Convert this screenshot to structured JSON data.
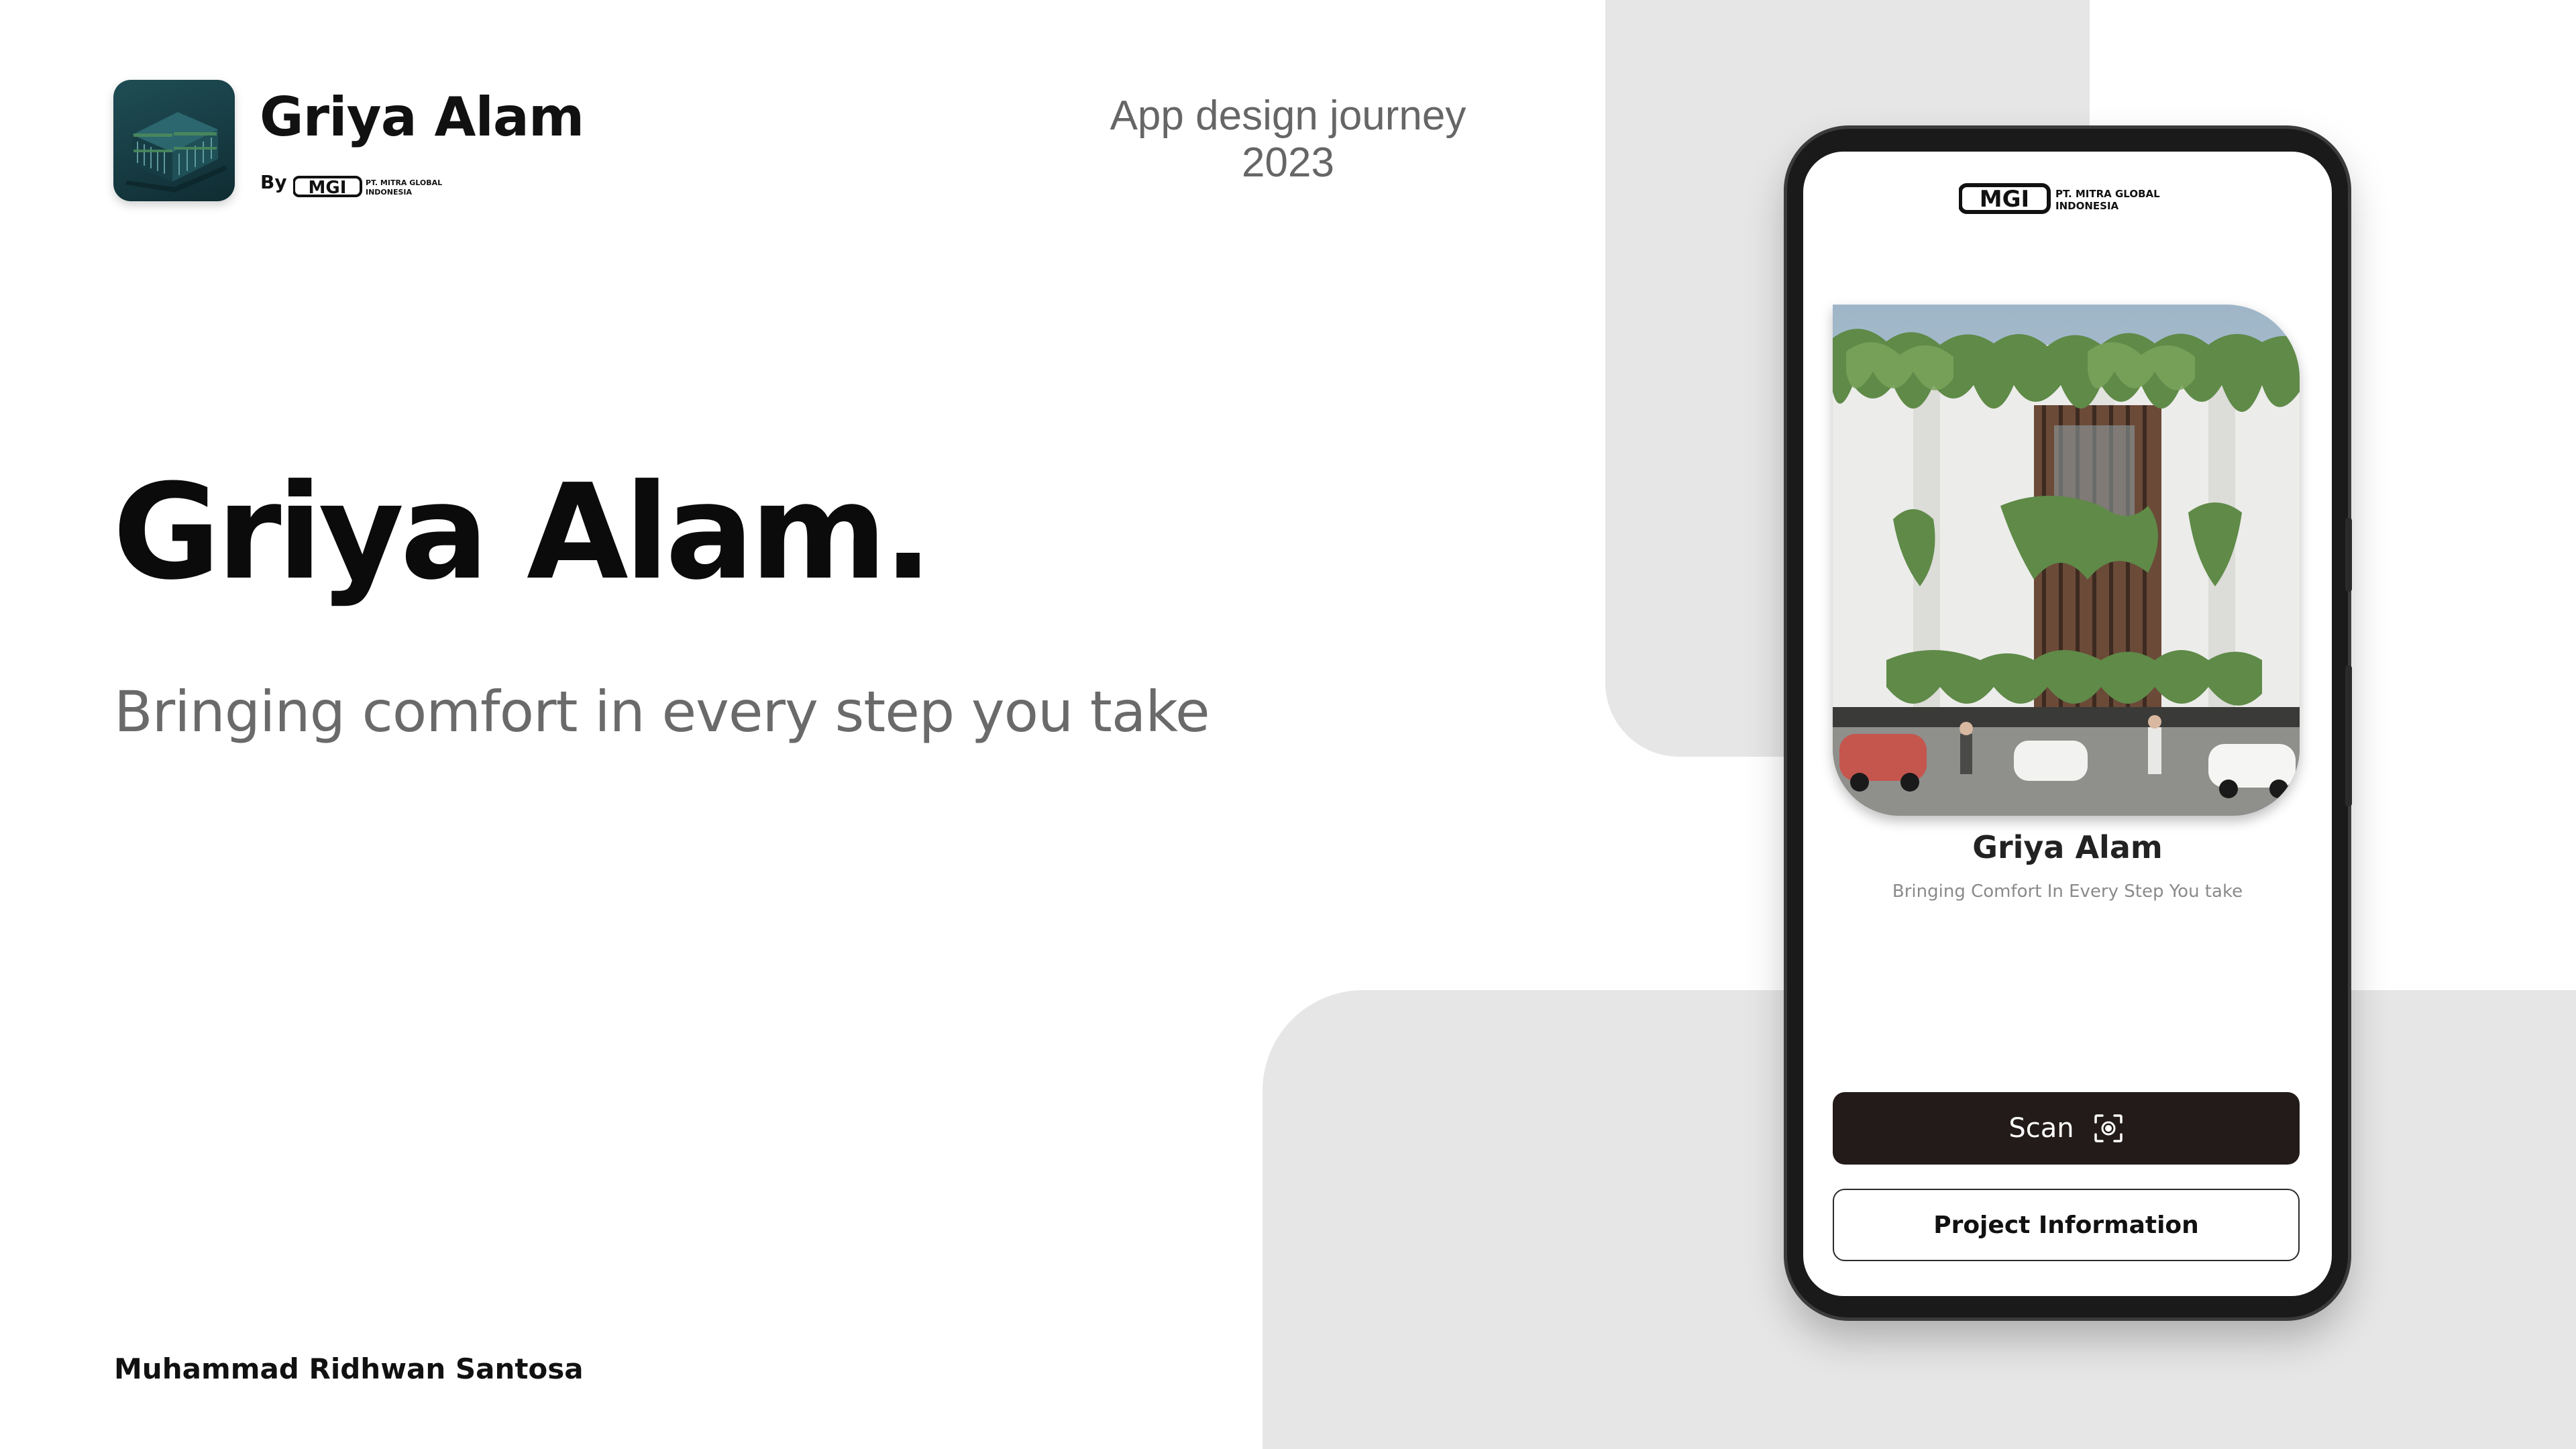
{
  "brand": {
    "app_name": "Griya Alam",
    "by_label": "By",
    "company_logo_text": "MGI",
    "company_name_line1": "PT. MITRA GLOBAL",
    "company_name_line2": "INDONESIA"
  },
  "journey": {
    "line1": "App design journey",
    "line2": "2023"
  },
  "hero": {
    "title": "Griya Alam.",
    "tagline": "Bringing comfort in every step you take"
  },
  "author": "Muhammad Ridhwan Santosa",
  "phone": {
    "logo_text": "MGI",
    "logo_line1": "PT. MITRA GLOBAL",
    "logo_line2": "INDONESIA",
    "card_title": "Griya Alam",
    "card_subtitle": "Bringing Comfort In Every Step You take",
    "scan_label": "Scan",
    "scan_icon": "scan-icon",
    "project_info_label": "Project Information"
  },
  "colors": {
    "background": "#ffffff",
    "panel": "#e6e6e6",
    "primary_button": "#231b19",
    "app_icon": "#1f4d55",
    "tagline": "#6a6a6a"
  }
}
